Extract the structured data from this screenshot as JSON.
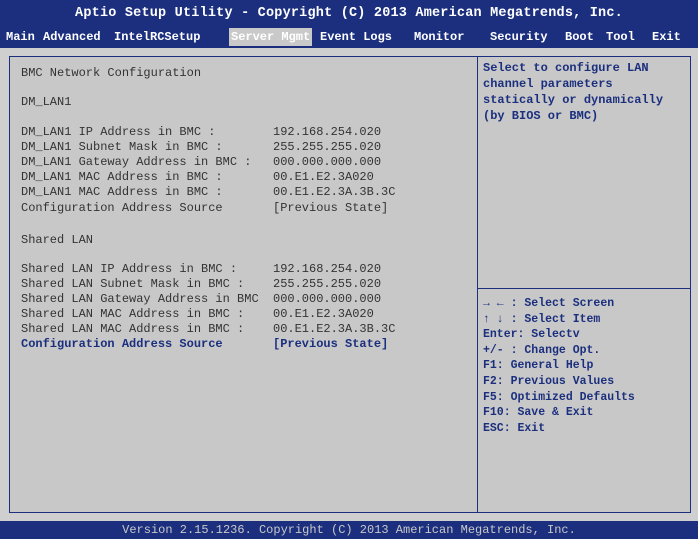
{
  "header": {
    "title": "Aptio Setup Utility - Copyright (C) 2013 American Megatrends, Inc.",
    "tabs": [
      {
        "label": "Main"
      },
      {
        "label": "Advanced"
      },
      {
        "label": "IntelRCSetup"
      },
      {
        "label": "Server Mgmt",
        "active": true
      },
      {
        "label": "Event Logs"
      },
      {
        "label": "Monitor"
      },
      {
        "label": "Security"
      },
      {
        "label": "Boot"
      },
      {
        "label": "Tool"
      },
      {
        "label": "Exit"
      }
    ]
  },
  "main": {
    "heading": "BMC Network Configuration",
    "dm_lan_heading": "DM_LAN1",
    "dm_lan_rows": [
      {
        "label": "DM_LAN1 IP Address in BMC :",
        "value": "192.168.254.020"
      },
      {
        "label": "DM_LAN1 Subnet Mask in BMC :",
        "value": "255.255.255.020"
      },
      {
        "label": "DM_LAN1 Gateway Address in BMC :",
        "value": "000.000.000.000"
      },
      {
        "label": "DM_LAN1 MAC Address in BMC :",
        "value": "00.E1.E2.3A020"
      },
      {
        "label": "DM_LAN1 MAC Address in BMC :",
        "value": "00.E1.E2.3A.3B.3C"
      },
      {
        "label": "Configuration Address Source",
        "value": "[Previous State]"
      }
    ],
    "shared_heading": "Shared LAN",
    "shared_rows": [
      {
        "label": "Shared LAN IP Address in BMC :",
        "value": "192.168.254.020"
      },
      {
        "label": "Shared LAN Subnet Mask in BMC :",
        "value": "255.255.255.020"
      },
      {
        "label": "Shared LAN Gateway Address in BMC",
        "value": "000.000.000.000"
      },
      {
        "label": "Shared LAN MAC Address in BMC :",
        "value": "00.E1.E2.3A020"
      },
      {
        "label": "Shared LAN MAC Address in BMC :",
        "value": "00.E1.E2.3A.3B.3C"
      },
      {
        "label": "Configuration Address Source",
        "value": "[Previous State]",
        "selected": true
      }
    ]
  },
  "help": {
    "text": "Select to configure LAN channel parameters statically or dynamically (by BIOS or BMC)"
  },
  "keys": [
    "→ ← : Select Screen",
    "↑ ↓ : Select Item",
    "Enter: Selectv",
    "+/- : Change Opt.",
    "F1: General Help",
    "F2: Previous Values",
    "F5: Optimized Defaults",
    "F10: Save & Exit",
    "ESC: Exit"
  ],
  "footer": {
    "text": "Version 2.15.1236. Copyright (C) 2013 American Megatrends, Inc."
  },
  "colors": {
    "accent": "#1b2f7e",
    "background": "#c8c8c8",
    "text": "#333333"
  }
}
